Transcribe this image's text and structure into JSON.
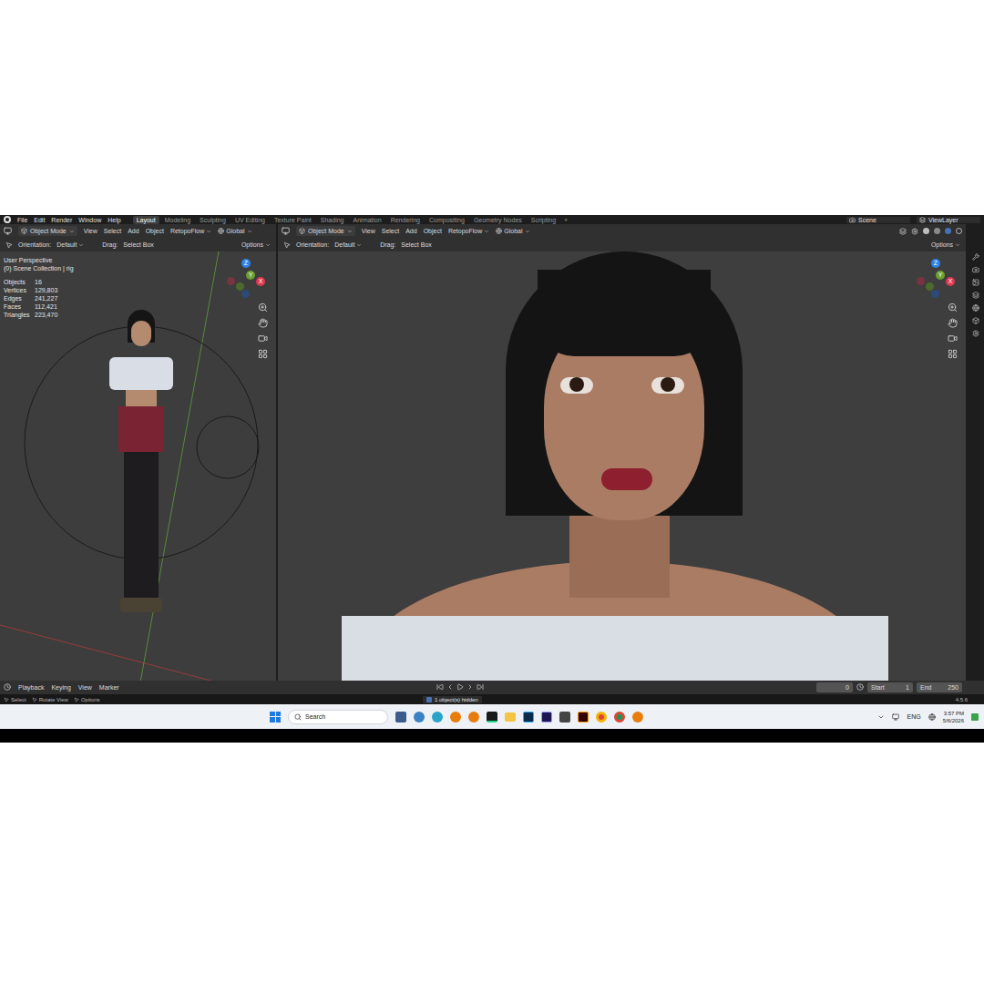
{
  "menu": [
    "File",
    "Edit",
    "Render",
    "Window",
    "Help"
  ],
  "workspaces": [
    {
      "label": "Layout",
      "selected": true
    },
    {
      "label": "Modeling",
      "selected": false
    },
    {
      "label": "Sculpting",
      "selected": false
    },
    {
      "label": "UV Editing",
      "selected": false
    },
    {
      "label": "Texture Paint",
      "selected": false
    },
    {
      "label": "Shading",
      "selected": false
    },
    {
      "label": "Animation",
      "selected": false
    },
    {
      "label": "Rendering",
      "selected": false
    },
    {
      "label": "Compositing",
      "selected": false
    },
    {
      "label": "Geometry Nodes",
      "selected": false
    },
    {
      "label": "Scripting",
      "selected": false
    }
  ],
  "add_workspace": "+",
  "scene": "Scene",
  "view_layer": "ViewLayer",
  "viewports": [
    {
      "mode": "Object Mode",
      "menus": [
        "View",
        "Select",
        "Add",
        "Object"
      ],
      "addon": "RetopoFlow",
      "transform": "Global",
      "orientation_label": "Orientation:",
      "orientation": "Default",
      "drag_label": "Drag:",
      "drag": "Select Box",
      "options": "Options"
    },
    {
      "mode": "Object Mode",
      "menus": [
        "View",
        "Select",
        "Add",
        "Object"
      ],
      "addon": "RetopoFlow",
      "transform": "Global",
      "orientation_label": "Orientation:",
      "orientation": "Default",
      "drag_label": "Drag:",
      "drag": "Select Box",
      "options": "Options"
    }
  ],
  "gizmo_axes": [
    "Z",
    "Y",
    "X"
  ],
  "left_overlay": {
    "view": "User Perspective",
    "collection": "(0) Scene Collection | rig",
    "stats": [
      {
        "label": "Objects",
        "value": "16"
      },
      {
        "label": "Vertices",
        "value": "129,803"
      },
      {
        "label": "Edges",
        "value": "241,227"
      },
      {
        "label": "Faces",
        "value": "112,421"
      },
      {
        "label": "Triangles",
        "value": "223,470"
      }
    ]
  },
  "timeline": {
    "menus": [
      "Playback",
      "Keying",
      "View",
      "Marker"
    ],
    "frame": "0",
    "start_label": "Start",
    "start": "1",
    "end_label": "End",
    "end": "250"
  },
  "status_bar": {
    "hints": [
      "Select",
      "Rotate View",
      "Options"
    ],
    "message": "1 object(s) hidden",
    "version": "4.5.6"
  },
  "taskbar": {
    "search": "Search",
    "language": "ENG",
    "time": "3:57 PM",
    "date": "5/6/2026"
  }
}
